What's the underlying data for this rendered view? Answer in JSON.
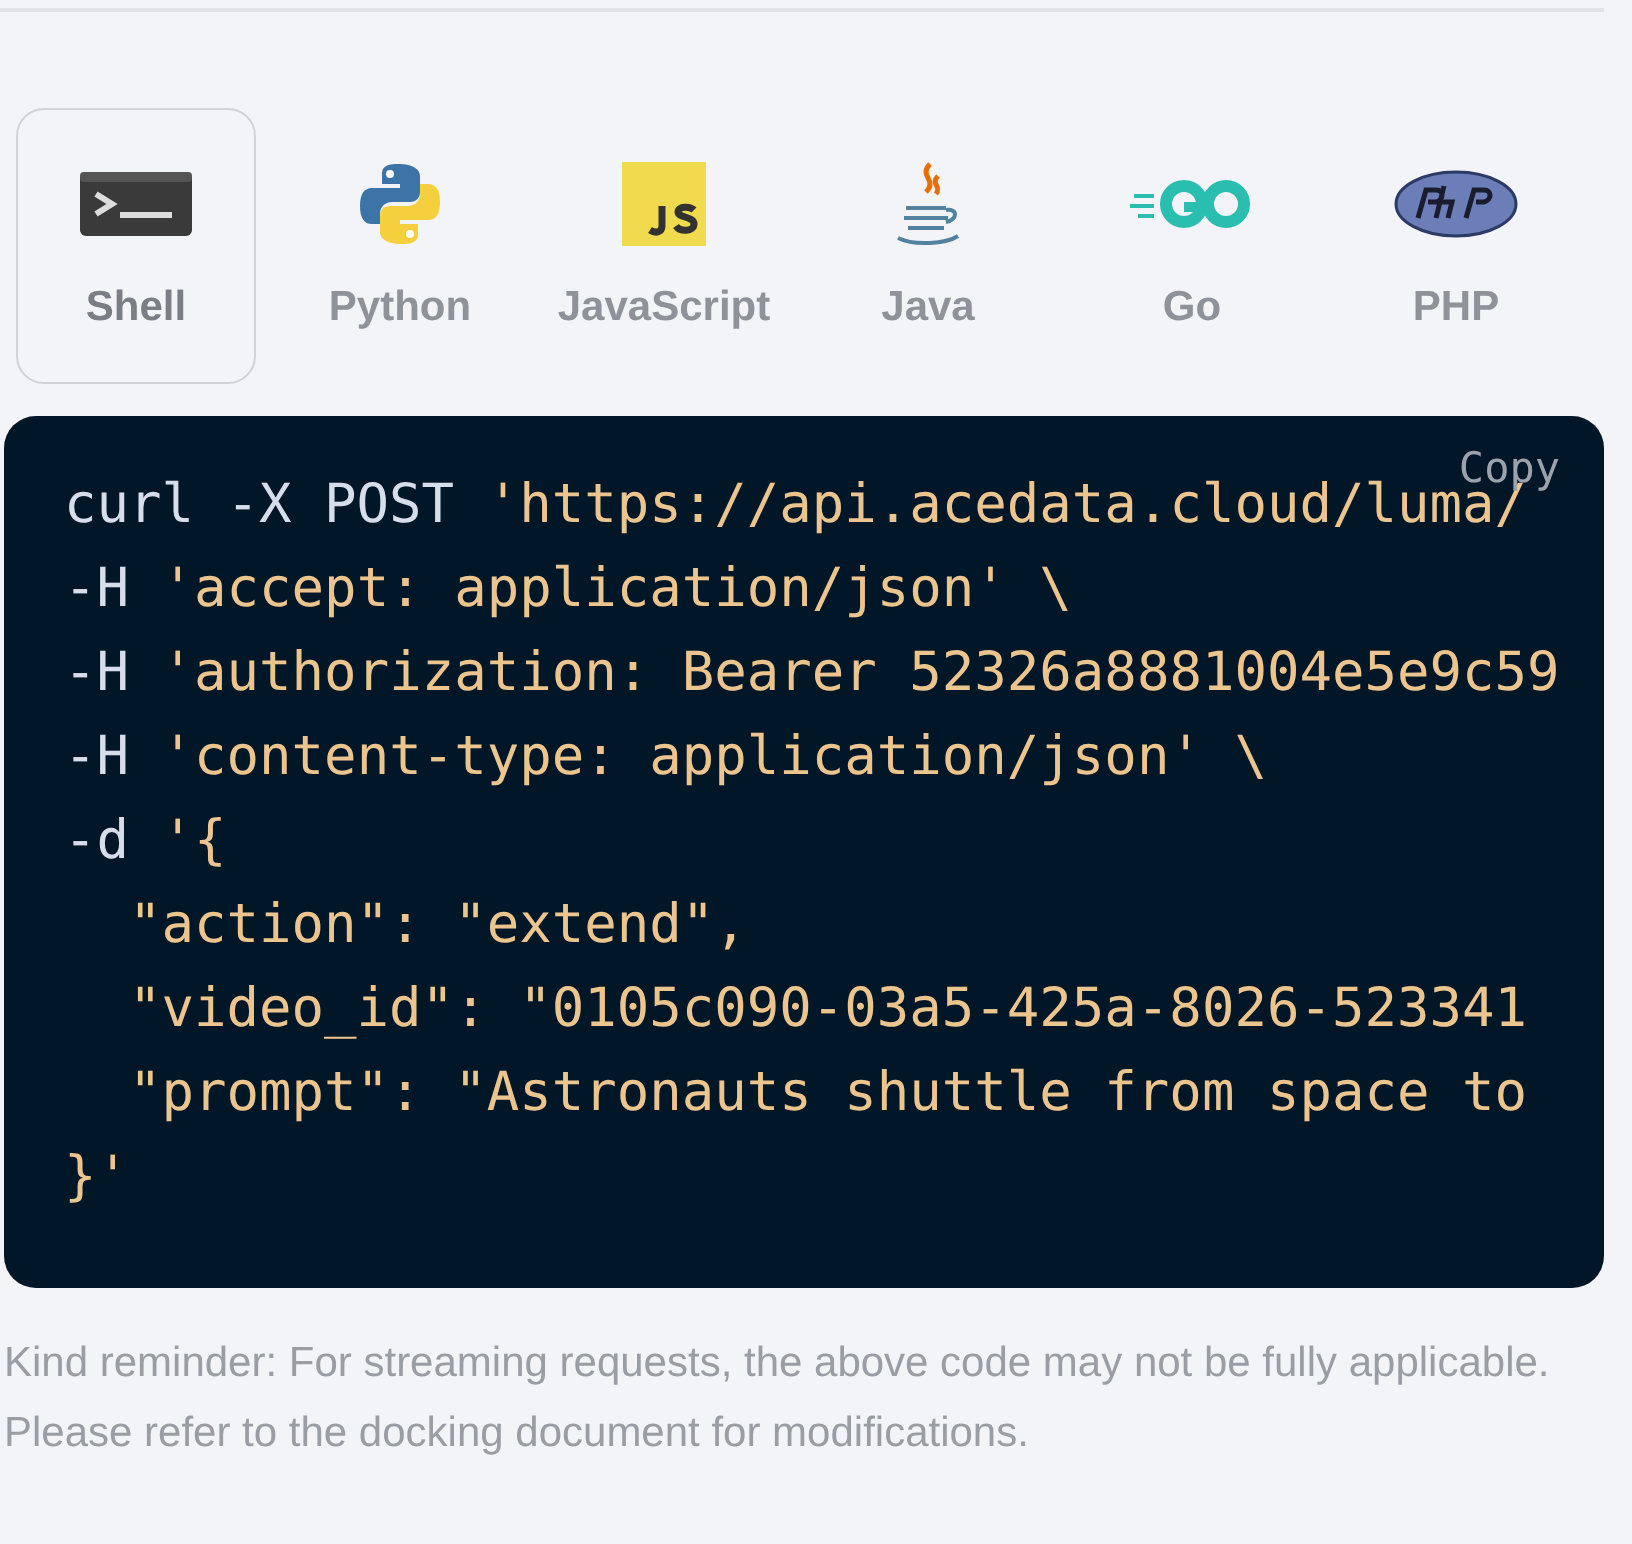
{
  "tabs": [
    {
      "label": "Shell",
      "kind": "shell",
      "selected": true
    },
    {
      "label": "Python",
      "kind": "python",
      "selected": false
    },
    {
      "label": "JavaScript",
      "kind": "javascript",
      "selected": false
    },
    {
      "label": "Java",
      "kind": "java",
      "selected": false
    },
    {
      "label": "Go",
      "kind": "go",
      "selected": false
    },
    {
      "label": "PHP",
      "kind": "php",
      "selected": false
    }
  ],
  "code": {
    "copy_label": "Copy",
    "lines": [
      [
        {
          "kind": "plain",
          "text": "curl -X POST "
        },
        {
          "kind": "string",
          "text": "'https://api.acedata.cloud/luma/"
        }
      ],
      [
        {
          "kind": "plain",
          "text": "-H "
        },
        {
          "kind": "string",
          "text": "'accept: application/json' \\"
        }
      ],
      [
        {
          "kind": "plain",
          "text": "-H "
        },
        {
          "kind": "string",
          "text": "'authorization: Bearer 52326a8881004e5e9c59"
        }
      ],
      [
        {
          "kind": "plain",
          "text": "-H "
        },
        {
          "kind": "string",
          "text": "'content-type: application/json' \\"
        }
      ],
      [
        {
          "kind": "plain",
          "text": "-d "
        },
        {
          "kind": "string",
          "text": "'{"
        }
      ],
      [
        {
          "kind": "string",
          "text": "  \"action\": \"extend\","
        }
      ],
      [
        {
          "kind": "string",
          "text": "  \"video_id\": \"0105c090-03a5-425a-8026-523341"
        }
      ],
      [
        {
          "kind": "string",
          "text": "  \"prompt\": \"Astronauts shuttle from space to"
        }
      ],
      [
        {
          "kind": "string",
          "text": "}'"
        }
      ]
    ]
  },
  "note": "Kind reminder: For streaming requests, the above code may not be fully applicable. Please refer to the docking document for modifications."
}
